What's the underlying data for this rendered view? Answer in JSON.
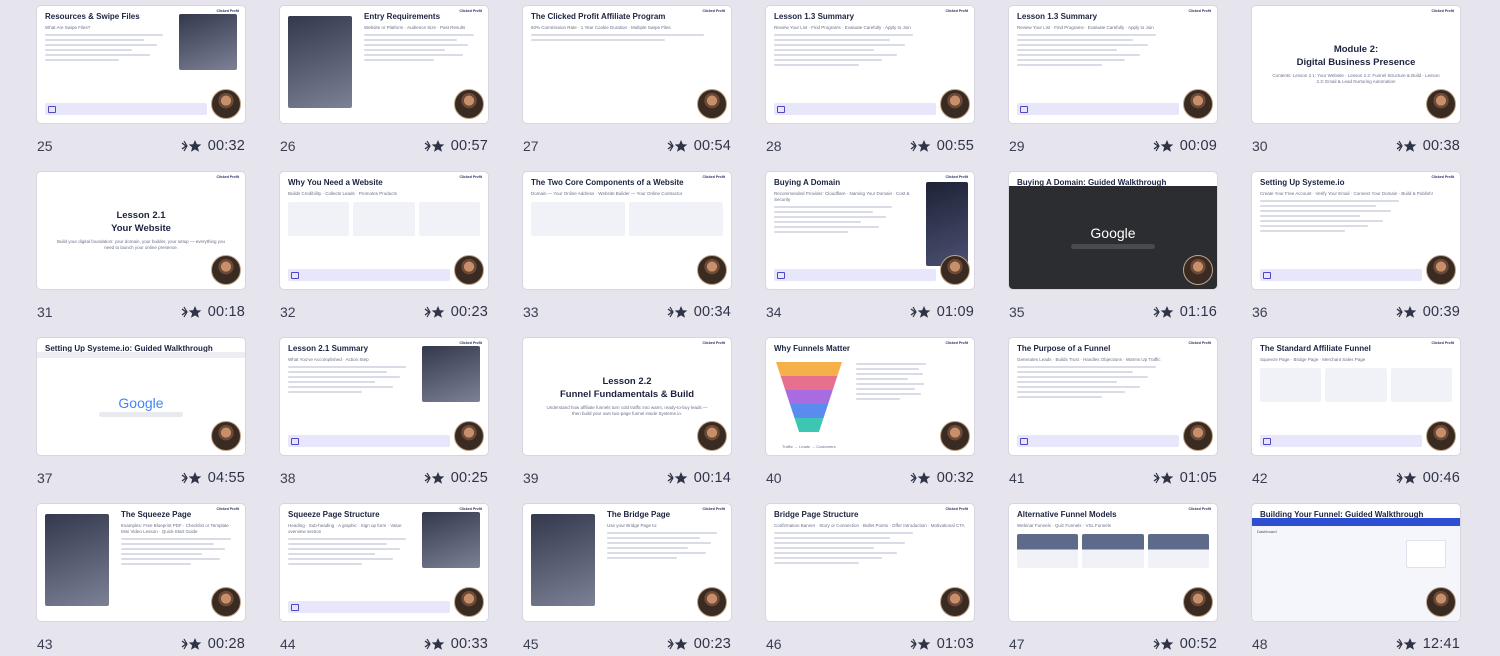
{
  "tiles": [
    {
      "num": "25",
      "duration": "00:32",
      "slide_title": "Resources & Swipe Files",
      "slide_sub": "What Are Swipe Files?",
      "kind": "text-image"
    },
    {
      "num": "26",
      "duration": "00:57",
      "slide_title": "Entry Requirements",
      "slide_sub": "Website or Platform · Audience Size · Past Results",
      "kind": "image-text"
    },
    {
      "num": "27",
      "duration": "00:54",
      "slide_title": "The Clicked Profit Affiliate Program",
      "slide_sub": "50% Commission Rate · 1 Year Cookie Duration · Multiple Swipe Files",
      "kind": "stats"
    },
    {
      "num": "28",
      "duration": "00:55",
      "slide_title": "Lesson 1.3 Summary",
      "slide_sub": "Review Your List · Find Programs · Evaluate Carefully · Apply to Join",
      "kind": "summary"
    },
    {
      "num": "29",
      "duration": "00:09",
      "slide_title": "Lesson 1.3 Summary",
      "slide_sub": "Review Your List · Find Programs · Evaluate Carefully · Apply to Join",
      "kind": "summary"
    },
    {
      "num": "30",
      "duration": "00:38",
      "slide_title": "Module 2:\nDigital Business Presence",
      "slide_sub": "Contents: Lesson 2.1: Your Website · Lesson 2.2: Funnel Structure & Build · Lesson 2.3: Email & Lead Nurturing Automation",
      "kind": "module"
    },
    {
      "num": "31",
      "duration": "00:18",
      "slide_title": "Lesson 2.1\nYour Website",
      "slide_sub": "Build your digital foundation: your domain, your builder, your setup — everything you need to launch your online presence.",
      "kind": "lesson"
    },
    {
      "num": "32",
      "duration": "00:23",
      "slide_title": "Why You Need a Website",
      "slide_sub": "Builds Credibility · Collects Leads · Promotes Products",
      "kind": "three-col"
    },
    {
      "num": "33",
      "duration": "00:34",
      "slide_title": "The Two Core Components of a Website",
      "slide_sub": "Domain — Your Online Address · Website Builder — Your Online Contractor",
      "kind": "two-col"
    },
    {
      "num": "34",
      "duration": "01:09",
      "slide_title": "Buying A Domain",
      "slide_sub": "Recommended Provider: Cloudflare · Naming Your Domain · Cost & Security",
      "kind": "text-phone"
    },
    {
      "num": "35",
      "duration": "01:16",
      "slide_title": "Buying A Domain: Guided Walkthrough",
      "slide_sub": "Google",
      "kind": "google-dark"
    },
    {
      "num": "36",
      "duration": "00:39",
      "slide_title": "Setting Up Systeme.io",
      "slide_sub": "Create Your Free Account · Verify Your Email · Connect Your Domain · Build & Publish!",
      "kind": "summary"
    },
    {
      "num": "37",
      "duration": "04:55",
      "slide_title": "Setting Up Systeme.io: Guided Walkthrough",
      "slide_sub": "Google",
      "kind": "google-light"
    },
    {
      "num": "38",
      "duration": "00:25",
      "slide_title": "Lesson 2.1 Summary",
      "slide_sub": "What You've Accomplished · Action Step",
      "kind": "text-image"
    },
    {
      "num": "39",
      "duration": "00:14",
      "slide_title": "Lesson 2.2\nFunnel Fundamentals & Build",
      "slide_sub": "Understand how affiliate funnels turn cold traffic into warm, ready-to-buy leads — then build your own two-page funnel inside Systeme.io.",
      "kind": "lesson"
    },
    {
      "num": "40",
      "duration": "00:32",
      "slide_title": "Why Funnels Matter",
      "slide_sub": "Traffic → Leads → Customers",
      "kind": "funnel"
    },
    {
      "num": "41",
      "duration": "01:05",
      "slide_title": "The Purpose of a Funnel",
      "slide_sub": "Generates Leads · Builds Trust · Handles Objections · Warms Up Traffic",
      "kind": "summary"
    },
    {
      "num": "42",
      "duration": "00:46",
      "slide_title": "The Standard Affiliate Funnel",
      "slide_sub": "Squeeze Page · Bridge Page · Merchant Sales Page",
      "kind": "three-col"
    },
    {
      "num": "43",
      "duration": "00:28",
      "slide_title": "The Squeeze Page",
      "slide_sub": "Examples: Free Blueprint PDF · Checklist or Template · Mini Video Lesson · Quick-Start Guide",
      "kind": "image-text"
    },
    {
      "num": "44",
      "duration": "00:33",
      "slide_title": "Squeeze Page Structure",
      "slide_sub": "Heading · Sub-heading · A graphic · Sign up form · Value overview section",
      "kind": "text-image"
    },
    {
      "num": "45",
      "duration": "00:23",
      "slide_title": "The Bridge Page",
      "slide_sub": "Use your Bridge Page to:",
      "kind": "image-text"
    },
    {
      "num": "46",
      "duration": "01:03",
      "slide_title": "Bridge Page Structure",
      "slide_sub": "Confirmation Banner · Story or Connection · Bullet Points · Offer Introduction · Motivational CTA",
      "kind": "text"
    },
    {
      "num": "47",
      "duration": "00:52",
      "slide_title": "Alternative Funnel Models",
      "slide_sub": "Webinar Funnels · Quiz Funnels · VSL Funnels",
      "kind": "three-img"
    },
    {
      "num": "48",
      "duration": "12:41",
      "slide_title": "Building Your Funnel: Guided Walkthrough",
      "slide_sub": "Dashboard",
      "kind": "dashboard"
    }
  ],
  "brand_logo": "Clicked Profit",
  "colors": {
    "background": "#e6e5ee",
    "accent": "#4e47c7",
    "title": "#1c2340"
  },
  "icons": {
    "pin": "scissors-star-icon"
  }
}
